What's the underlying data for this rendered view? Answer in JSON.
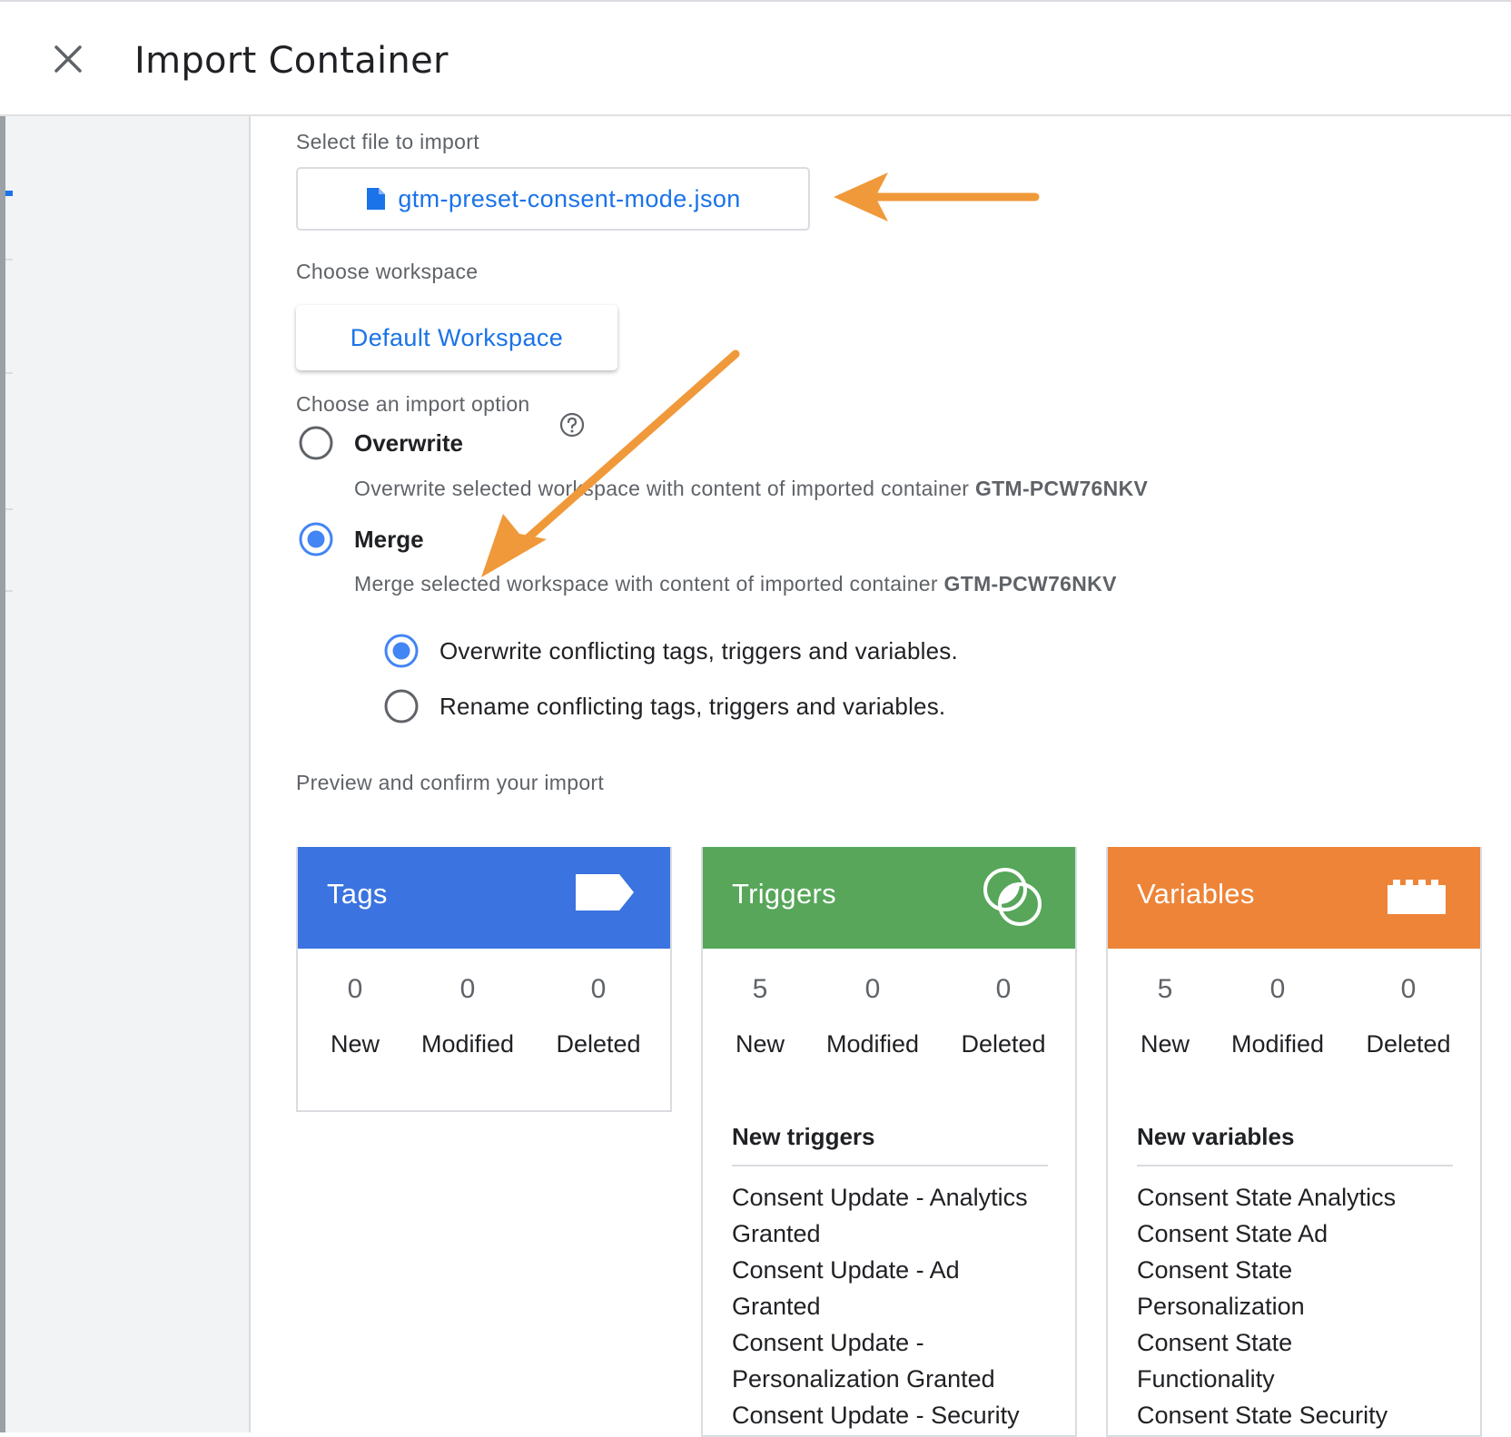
{
  "header": {
    "title": "Import Container",
    "close_icon": "close-icon"
  },
  "file_section": {
    "label": "Select file to import",
    "file_name": "gtm-preset-consent-mode.json",
    "icon": "file-icon"
  },
  "workspace_section": {
    "label": "Choose workspace",
    "workspace_name": "Default Workspace"
  },
  "import_option": {
    "label": "Choose an import option",
    "overwrite": {
      "title": "Overwrite",
      "desc_prefix": "Overwrite selected workspace with content of imported container ",
      "container_id": "GTM-PCW76NKV",
      "selected": false
    },
    "merge": {
      "title": "Merge",
      "desc_prefix": "Merge selected workspace with content of imported container ",
      "container_id": "GTM-PCW76NKV",
      "selected": true,
      "sub_options": [
        {
          "label": "Overwrite conflicting tags, triggers and variables.",
          "selected": true
        },
        {
          "label": "Rename conflicting tags, triggers and variables.",
          "selected": false
        }
      ]
    }
  },
  "preview": {
    "label": "Preview and confirm your import",
    "cards": [
      {
        "title": "Tags",
        "color": "#3b73e0",
        "icon": "tag-icon",
        "new": "0",
        "modified": "0",
        "deleted": "0",
        "new_label": "New",
        "modified_label": "Modified",
        "deleted_label": "Deleted"
      },
      {
        "title": "Triggers",
        "color": "#57a65a",
        "icon": "trigger-icon",
        "new": "5",
        "modified": "0",
        "deleted": "0",
        "new_label": "New",
        "modified_label": "Modified",
        "deleted_label": "Deleted",
        "list_title": "New triggers",
        "list_lines": [
          "Consent Update - Analytics",
          "Granted",
          "Consent Update - Ad",
          "Granted",
          "Consent Update -",
          "Personalization Granted",
          "Consent Update - Security"
        ]
      },
      {
        "title": "Variables",
        "color": "#ed8438",
        "icon": "variable-icon",
        "new": "5",
        "modified": "0",
        "deleted": "0",
        "new_label": "New",
        "modified_label": "Modified",
        "deleted_label": "Deleted",
        "list_title": "New variables",
        "list_lines": [
          "Consent State Analytics",
          "Consent State Ad",
          "Consent State",
          "Personalization",
          "Consent State",
          "Functionality",
          "Consent State Security"
        ]
      }
    ]
  },
  "annotation_color": "#f0993a"
}
